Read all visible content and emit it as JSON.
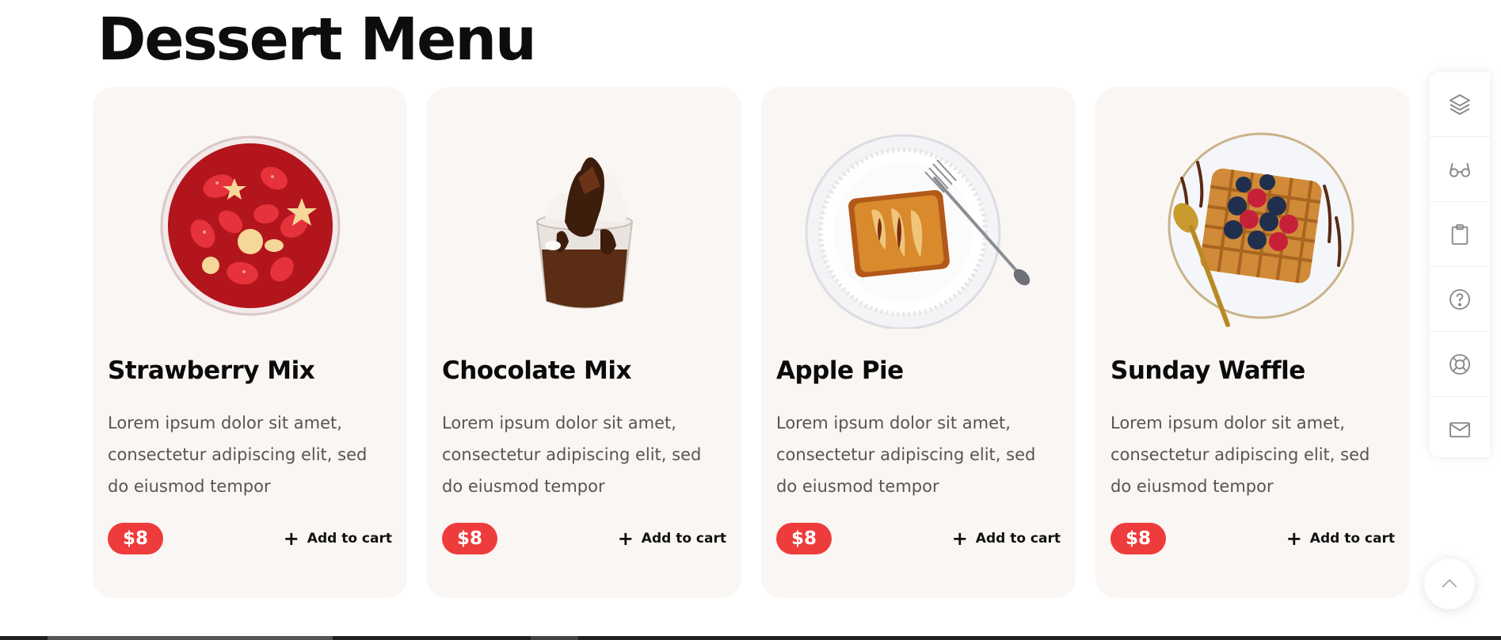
{
  "page": {
    "title": "Dessert Menu"
  },
  "cards": [
    {
      "name": "Strawberry Mix",
      "description": "Lorem ipsum dolor sit amet, consectetur adipiscing elit, sed do eiusmod tempor",
      "price": "$8",
      "cta": "Add to cart",
      "image": "strawberry-bowl"
    },
    {
      "name": "Chocolate Mix",
      "description": "Lorem ipsum dolor sit amet, consectetur adipiscing elit, sed do eiusmod tempor",
      "price": "$8",
      "cta": "Add to cart",
      "image": "chocolate-sundae"
    },
    {
      "name": "Apple Pie",
      "description": "Lorem ipsum dolor sit amet, consectetur adipiscing elit, sed do eiusmod tempor",
      "price": "$8",
      "cta": "Add to cart",
      "image": "apple-pie-plate"
    },
    {
      "name": "Sunday Waffle",
      "description": "Lorem ipsum dolor sit amet, consectetur adipiscing elit, sed do eiusmod tempor",
      "price": "$8",
      "cta": "Add to cart",
      "image": "berry-waffle-plate"
    }
  ],
  "toolbar": {
    "icons": [
      "layers-icon",
      "glasses-icon",
      "clipboard-icon",
      "help-circle-icon",
      "lifebuoy-icon",
      "mail-icon"
    ]
  },
  "scroll_top": {
    "icon": "chevron-up-icon"
  },
  "colors": {
    "accent": "#ee3c3c",
    "card_bg": "#faf6f3",
    "text_dark": "#0b0b0b",
    "text_muted": "#555555"
  }
}
